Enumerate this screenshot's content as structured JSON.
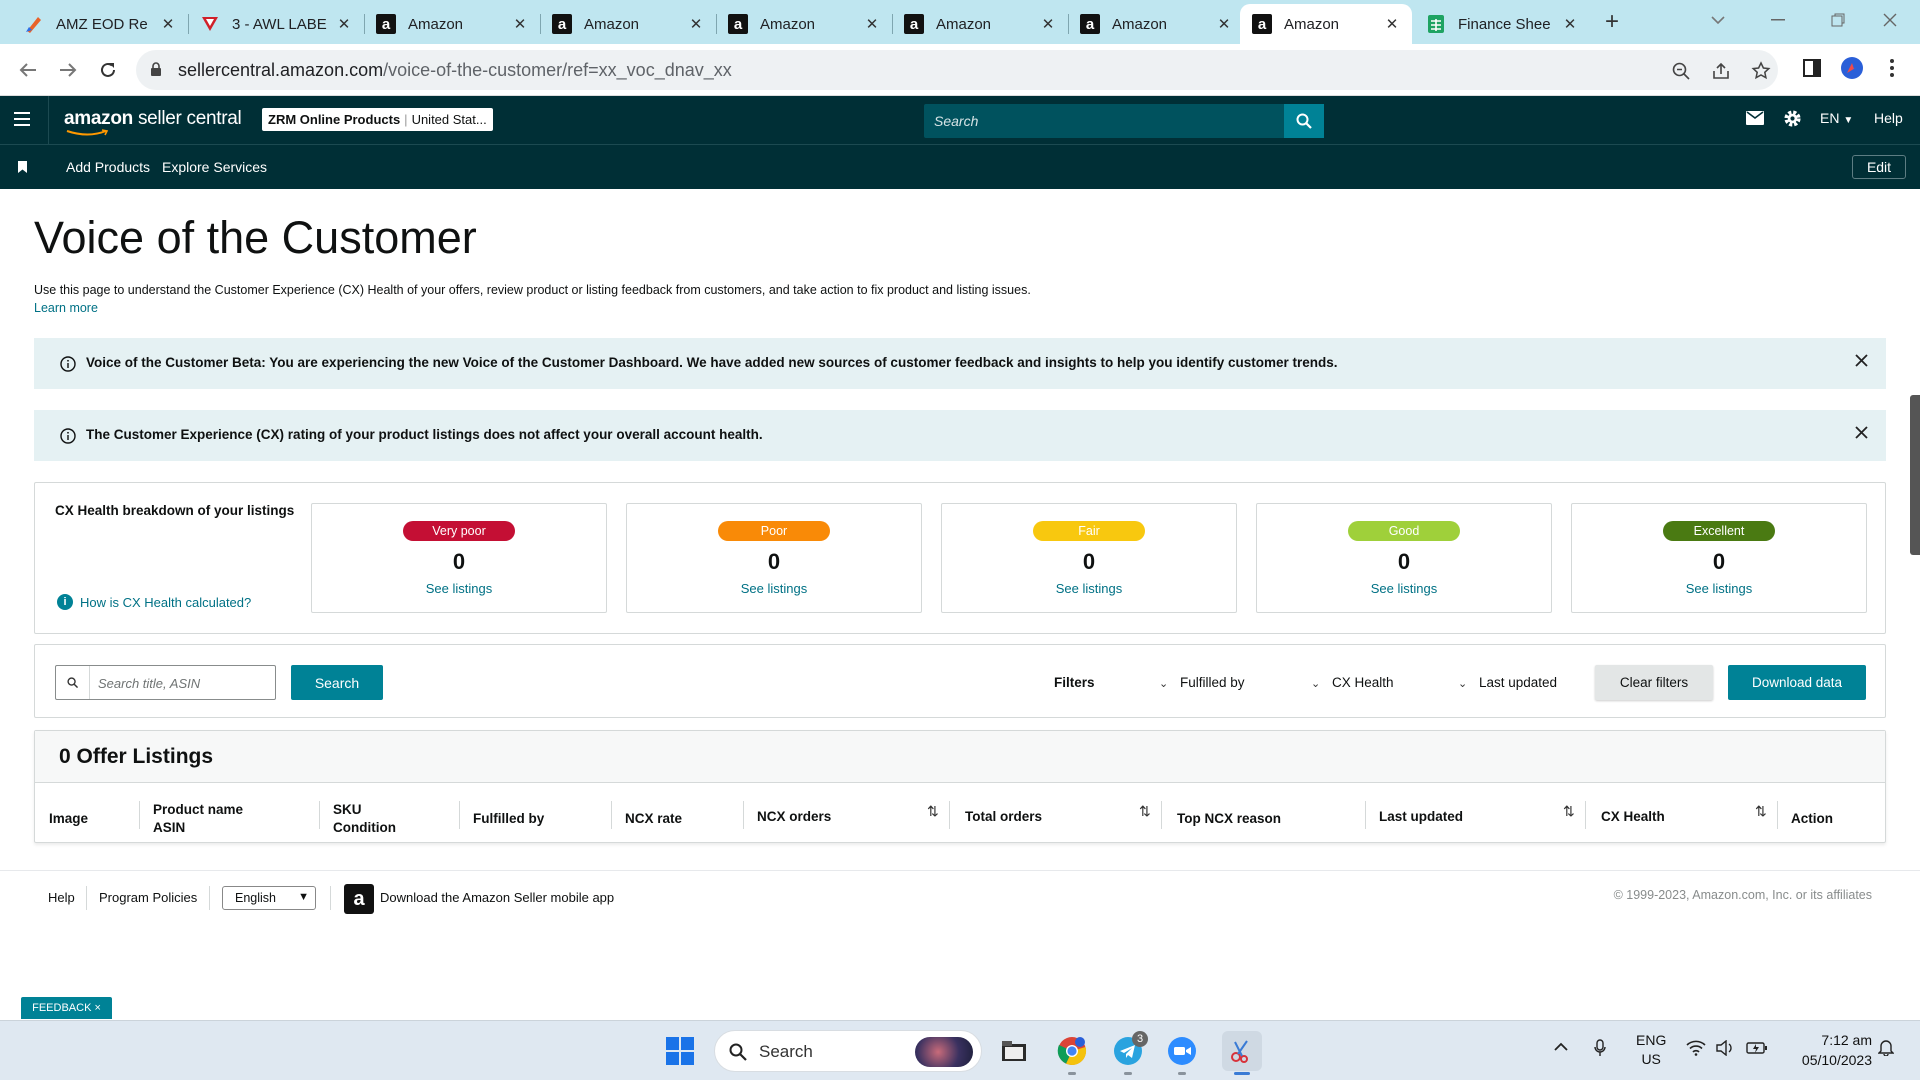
{
  "browser": {
    "tabs": [
      {
        "title": "AMZ EOD Re",
        "favicon": "amz-eod-icon"
      },
      {
        "title": "3 - AWL LABE",
        "favicon": "awl-icon"
      },
      {
        "title": "Amazon",
        "favicon": "amazon-icon"
      },
      {
        "title": "Amazon",
        "favicon": "amazon-icon"
      },
      {
        "title": "Amazon",
        "favicon": "amazon-icon"
      },
      {
        "title": "Amazon",
        "favicon": "amazon-icon"
      },
      {
        "title": "Amazon",
        "favicon": "amazon-icon"
      },
      {
        "title": "Amazon",
        "favicon": "amazon-icon",
        "active": true
      },
      {
        "title": "Finance Shee",
        "favicon": "sheets-icon"
      }
    ],
    "url_host": "sellercentral.amazon.com",
    "url_path": "/voice-of-the-customer/ref=xx_voc_dnav_xx"
  },
  "header": {
    "logo_amazon": "amazon",
    "logo_rest": "seller central",
    "store_name": "ZRM Online Products",
    "store_market": "United Stat...",
    "search_placeholder": "Search",
    "language": "EN",
    "help": "Help",
    "nav_links": [
      "Add Products",
      "Explore Services"
    ],
    "edit": "Edit"
  },
  "page": {
    "title": "Voice of the Customer",
    "intro": "Use this page to understand the Customer Experience (CX) Health of your offers, review product or listing feedback from customers, and take action to fix product and listing issues.",
    "learn_more": "Learn more",
    "banners": [
      "Voice of the Customer Beta: You are experiencing the new Voice of the Customer Dashboard. We have added new sources of customer feedback and insights to help you identify customer trends.",
      "The Customer Experience (CX) rating of your product listings does not affect your overall account health."
    ]
  },
  "cx_health": {
    "label": "CX Health breakdown of your listings",
    "how_link": "How is CX Health calculated?",
    "cards": [
      {
        "rating": "Very poor",
        "count": "0",
        "link": "See listings",
        "color": "#c40f34",
        "text_color": "#ffffff"
      },
      {
        "rating": "Poor",
        "count": "0",
        "link": "See listings",
        "color": "#f98a07",
        "text_color": "#ffffff"
      },
      {
        "rating": "Fair",
        "count": "0",
        "link": "See listings",
        "color": "#f8c80f",
        "text_color": "#ffffff"
      },
      {
        "rating": "Good",
        "count": "0",
        "link": "See listings",
        "color": "#9fd03a",
        "text_color": "#ffffff"
      },
      {
        "rating": "Excellent",
        "count": "0",
        "link": "See listings",
        "color": "#4a7a12",
        "text_color": "#ffffff"
      }
    ]
  },
  "filters": {
    "search_placeholder": "Search title, ASIN",
    "search_button": "Search",
    "filters_label": "Filters",
    "fulfilled_by": "Fulfilled by",
    "cx_health": "CX Health",
    "last_updated": "Last updated",
    "clear": "Clear filters",
    "download": "Download data"
  },
  "listings": {
    "title": "0 Offer Listings",
    "columns": {
      "image": "Image",
      "product_name": "Product name",
      "asin": "ASIN",
      "sku": "SKU",
      "condition": "Condition",
      "fulfilled_by": "Fulfilled by",
      "ncx_rate": "NCX rate",
      "ncx_orders": "NCX orders",
      "total_orders": "Total orders",
      "top_ncx_reason": "Top NCX reason",
      "last_updated": "Last updated",
      "cx_health": "CX Health",
      "action": "Action"
    }
  },
  "footer": {
    "help": "Help",
    "policies": "Program Policies",
    "language": "English",
    "app_link": "Download the Amazon Seller mobile app",
    "copyright": "© 1999-2023, Amazon.com, Inc. or its affiliates"
  },
  "feedback": "FEEDBACK ×",
  "taskbar": {
    "search": "Search",
    "telegram_badge": "3",
    "lang_top": "ENG",
    "lang_bottom": "US",
    "time": "7:12 am",
    "date": "05/10/2023"
  }
}
